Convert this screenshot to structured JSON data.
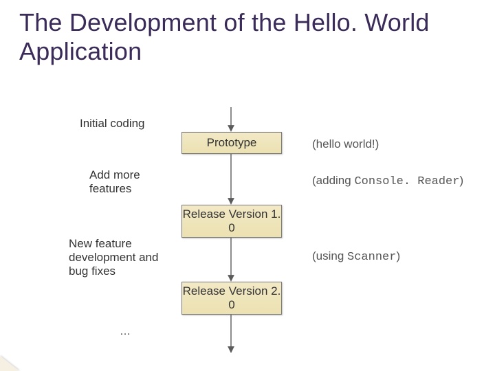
{
  "title": "The Development of the Hello. World Application",
  "labels": {
    "initial_coding": "Initial coding",
    "add_more": "Add more features",
    "new_feature": "New feature development and bug fixes",
    "ellipsis": "…"
  },
  "boxes": {
    "prototype": "Prototype",
    "release1": "Release Version 1. 0",
    "release2": "Release Version 2. 0"
  },
  "annot": {
    "hello": "(hello world!)",
    "adding_pre": "(adding ",
    "adding_code": "Console. Reader",
    "adding_post": ")",
    "using_pre": "(using ",
    "using_code": "Scanner",
    "using_post": ")"
  }
}
